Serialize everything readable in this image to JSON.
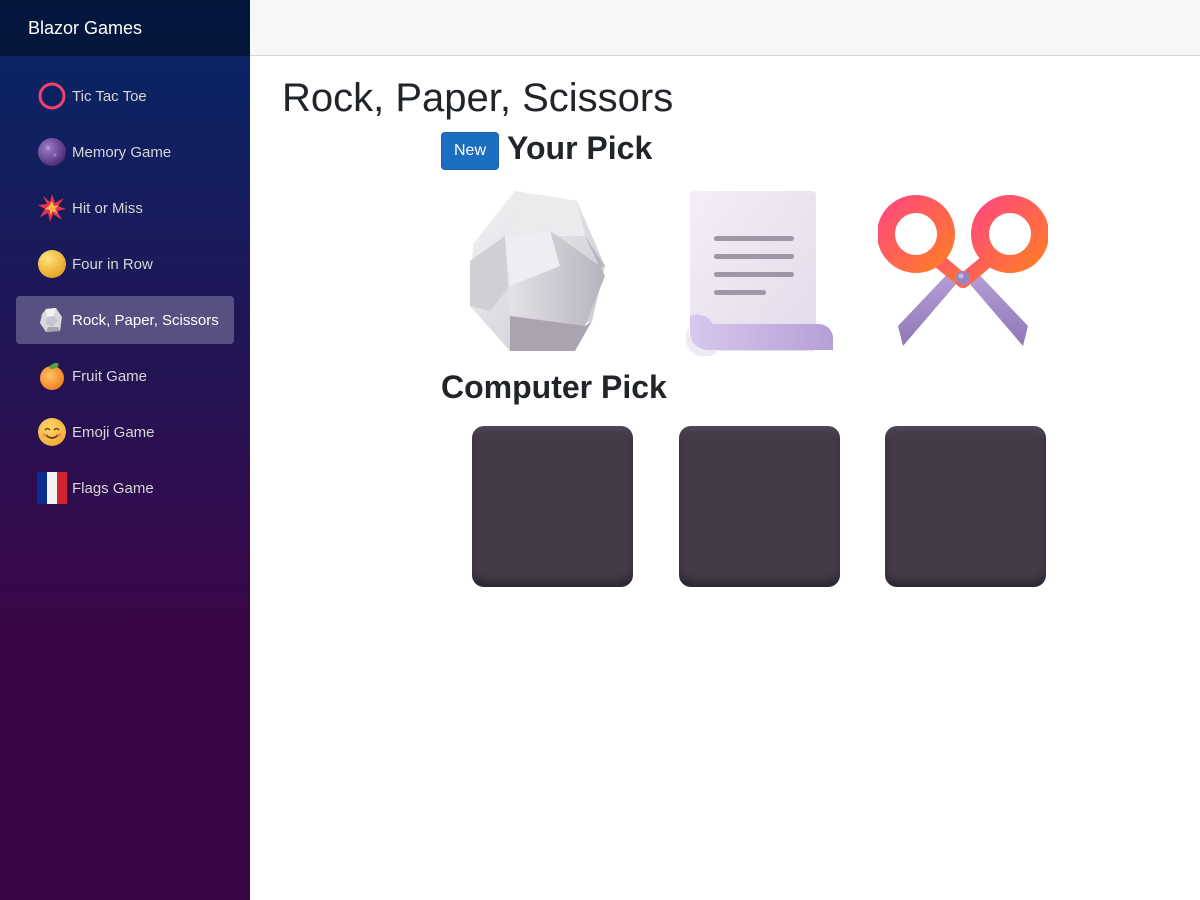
{
  "app": {
    "brand": "Blazor Games"
  },
  "sidebar": {
    "items": [
      {
        "label": "Tic Tac Toe",
        "icon": "ring-icon",
        "active": false
      },
      {
        "label": "Memory Game",
        "icon": "crystal-ball-icon",
        "active": false
      },
      {
        "label": "Hit or Miss",
        "icon": "collision-icon",
        "active": false
      },
      {
        "label": "Four in Row",
        "icon": "yellow-circle-icon",
        "active": false
      },
      {
        "label": "Rock, Paper, Scissors",
        "icon": "rock-icon",
        "active": true
      },
      {
        "label": "Fruit Game",
        "icon": "tangerine-icon",
        "active": false
      },
      {
        "label": "Emoji Game",
        "icon": "smiling-face-icon",
        "active": false
      },
      {
        "label": "Flags Game",
        "icon": "flag-france-icon",
        "active": false
      }
    ]
  },
  "main": {
    "title": "Rock, Paper, Scissors",
    "new_button_label": "New",
    "your_pick_label": "Your Pick",
    "computer_pick_label": "Computer Pick",
    "choices": [
      {
        "name": "rock",
        "icon": "rock-icon"
      },
      {
        "name": "paper",
        "icon": "page-curl-icon"
      },
      {
        "name": "scissors",
        "icon": "scissors-icon"
      }
    ],
    "computer_tiles": [
      {
        "state": "hidden"
      },
      {
        "state": "hidden"
      },
      {
        "state": "hidden"
      }
    ]
  },
  "colors": {
    "sidebar_top": "#052767",
    "sidebar_bottom": "#3a0647",
    "button_primary": "#1b6ec2",
    "tile_dark": "#433b48"
  }
}
